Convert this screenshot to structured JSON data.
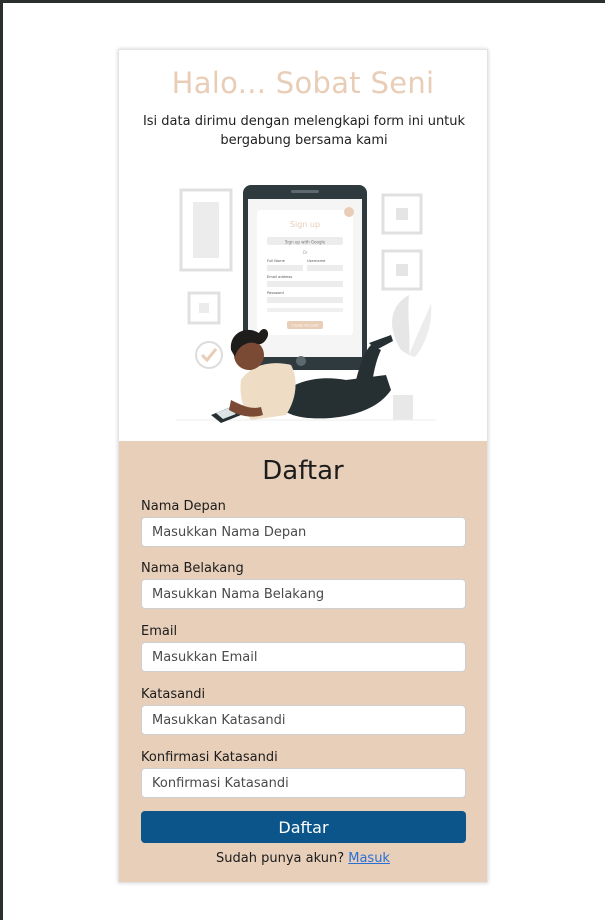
{
  "hero": {
    "title": "Halo... Sobat Seni",
    "subtitle": "Isi data dirimu dengan melengkapi form ini untuk bergabung bersama kami"
  },
  "illustration": {
    "signup_title": "Sign up",
    "google_button": "Sign up with Google",
    "or_text": "Or",
    "first_name_label": "Full Name",
    "last_name_label": "Username",
    "email_label": "Email address",
    "password_label": "Password",
    "create_button": "Create Account"
  },
  "form": {
    "title": "Daftar",
    "fields": [
      {
        "label": "Nama Depan",
        "placeholder": "Masukkan Nama Depan"
      },
      {
        "label": "Nama Belakang",
        "placeholder": "Masukkan Nama Belakang"
      },
      {
        "label": "Email",
        "placeholder": "Masukkan Email"
      },
      {
        "label": "Katasandi",
        "placeholder": "Masukkan Katasandi"
      },
      {
        "label": "Konfirmasi Katasandi",
        "placeholder": "Konfirmasi Katasandi"
      }
    ],
    "submit_label": "Daftar",
    "login_prompt": "Sudah punya akun?",
    "login_link": "Masuk"
  },
  "colors": {
    "accent": "#e8cfb9",
    "title": "#e8cdb7",
    "button": "#0b558a",
    "link": "#2a6fd6"
  }
}
